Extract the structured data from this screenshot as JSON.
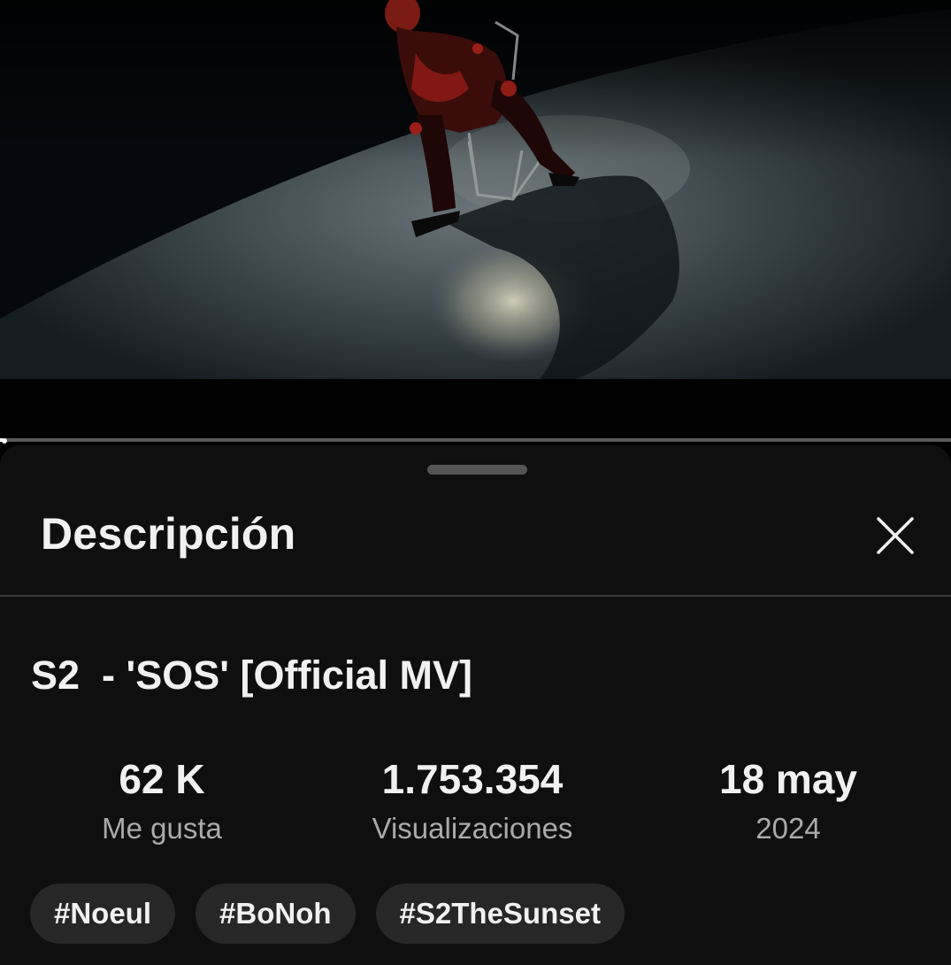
{
  "video": {
    "progress_percent": 0.3
  },
  "description_panel": {
    "title": "Descripción",
    "close_icon": "close-icon"
  },
  "video_info": {
    "title": "S2  - 'SOS' [Official MV]",
    "stats": [
      {
        "value": "62 K",
        "label": "Me gusta"
      },
      {
        "value": "1.753.354",
        "label": "Visualizaciones"
      },
      {
        "value": "18 may",
        "label": "2024"
      }
    ],
    "hashtags": [
      "#Noeul",
      "#BoNoh",
      "#S2TheSunset"
    ]
  },
  "colors": {
    "sheet_background": "#0f0f0f",
    "chip_background": "#272727",
    "primary_text": "#f1f1f1",
    "secondary_text": "#aaaaaa"
  }
}
